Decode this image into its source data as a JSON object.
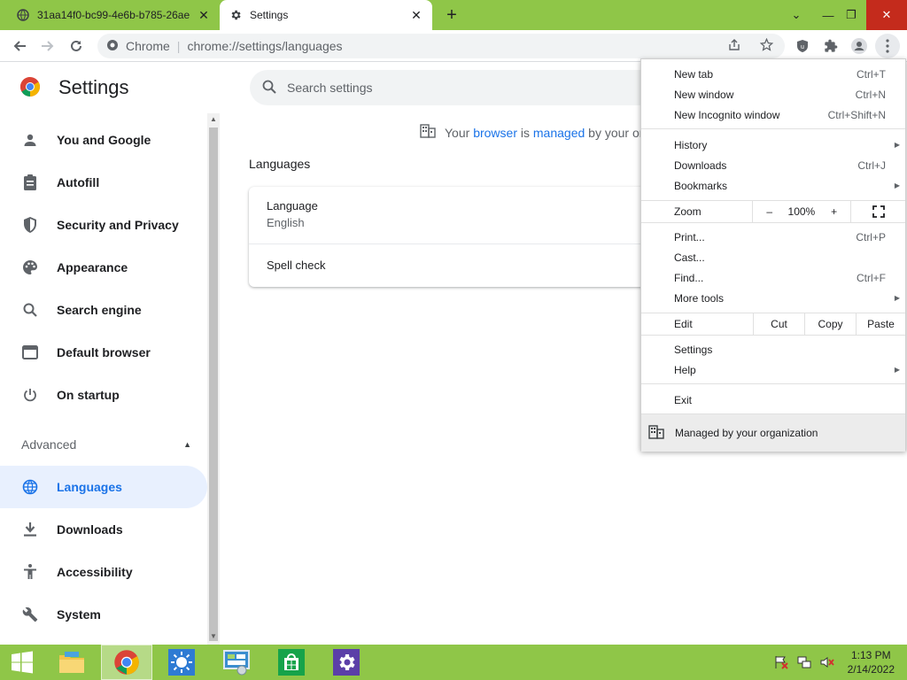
{
  "tabs": [
    {
      "title": "31aa14f0-bc99-4e6b-b785-26ae"
    },
    {
      "title": "Settings"
    }
  ],
  "omnibox": {
    "site": "Chrome",
    "separator": "|",
    "url": "chrome://settings/languages"
  },
  "settings": {
    "title": "Settings",
    "search_placeholder": "Search settings",
    "managed": {
      "prefix": "Your",
      "browser": "browser",
      "is": "is",
      "managed": "managed",
      "suffix": "by your orga"
    },
    "section_title": "Languages",
    "language_label": "Language",
    "language_value": "English",
    "spell_check": "Spell check"
  },
  "sidebar": {
    "items": [
      {
        "label": "You and Google",
        "icon": "person-icon"
      },
      {
        "label": "Autofill",
        "icon": "clipboard-icon"
      },
      {
        "label": "Security and Privacy",
        "icon": "shield-icon"
      },
      {
        "label": "Appearance",
        "icon": "palette-icon"
      },
      {
        "label": "Search engine",
        "icon": "search-icon"
      },
      {
        "label": "Default browser",
        "icon": "browser-icon"
      },
      {
        "label": "On startup",
        "icon": "power-icon"
      }
    ],
    "advanced_label": "Advanced",
    "advanced_items": [
      {
        "label": "Languages",
        "icon": "globe-icon"
      },
      {
        "label": "Downloads",
        "icon": "download-icon"
      },
      {
        "label": "Accessibility",
        "icon": "accessibility-icon"
      },
      {
        "label": "System",
        "icon": "wrench-icon"
      }
    ]
  },
  "menu": {
    "new_tab": {
      "label": "New tab",
      "shortcut": "Ctrl+T"
    },
    "new_window": {
      "label": "New window",
      "shortcut": "Ctrl+N"
    },
    "new_incognito": {
      "label": "New Incognito window",
      "shortcut": "Ctrl+Shift+N"
    },
    "history": {
      "label": "History"
    },
    "downloads": {
      "label": "Downloads",
      "shortcut": "Ctrl+J"
    },
    "bookmarks": {
      "label": "Bookmarks"
    },
    "zoom": {
      "label": "Zoom",
      "minus": "–",
      "value": "100%",
      "plus": "+"
    },
    "print": {
      "label": "Print...",
      "shortcut": "Ctrl+P"
    },
    "cast": {
      "label": "Cast..."
    },
    "find": {
      "label": "Find...",
      "shortcut": "Ctrl+F"
    },
    "more_tools": {
      "label": "More tools"
    },
    "edit": {
      "label": "Edit",
      "cut": "Cut",
      "copy": "Copy",
      "paste": "Paste"
    },
    "settings": {
      "label": "Settings"
    },
    "help": {
      "label": "Help"
    },
    "exit": {
      "label": "Exit"
    },
    "managed": {
      "label": "Managed by your organization"
    }
  },
  "taskbar": {
    "time": "1:13 PM",
    "date": "2/14/2022",
    "accent": "#8fc648"
  }
}
